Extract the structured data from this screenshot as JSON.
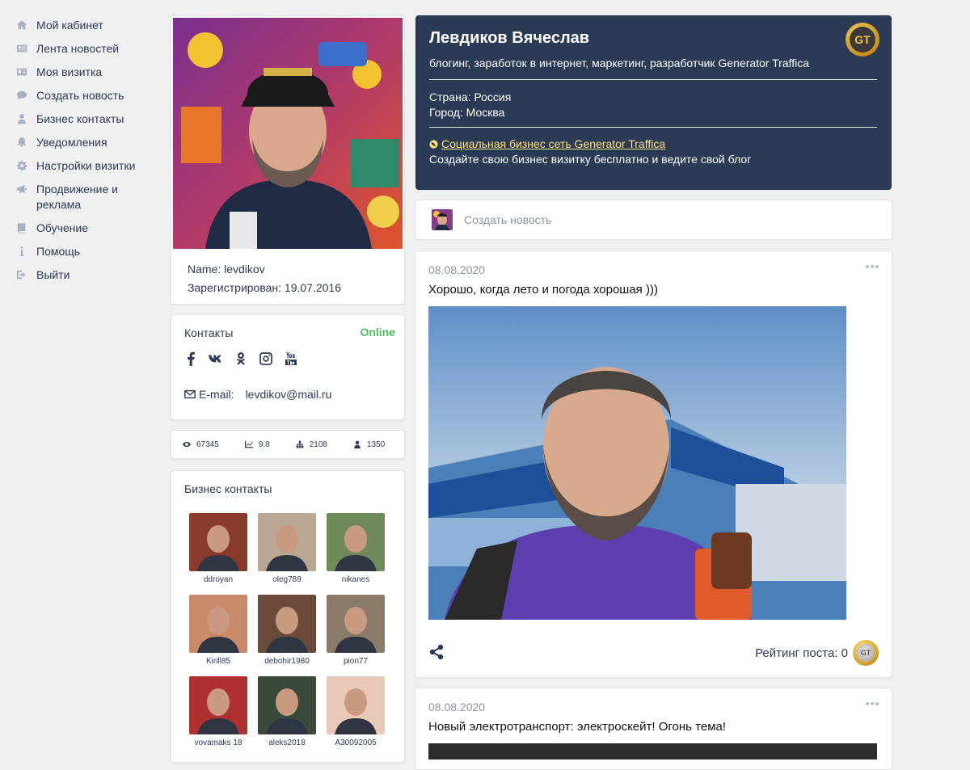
{
  "nav": {
    "items": [
      {
        "label": "Мой кабинет",
        "icon": "home-icon"
      },
      {
        "label": "Лента новостей",
        "icon": "newspaper-icon"
      },
      {
        "label": "Моя визитка",
        "icon": "id-card-icon"
      },
      {
        "label": "Создать новость",
        "icon": "comment-icon"
      },
      {
        "label": "Бизнес контакты",
        "icon": "user-icon"
      },
      {
        "label": "Уведомления",
        "icon": "bell-icon"
      },
      {
        "label": "Настройки визитки",
        "icon": "gear-icon"
      },
      {
        "label": "Продвижение и\nреклама",
        "icon": "bullhorn-icon"
      },
      {
        "label": "Обучение",
        "icon": "book-icon"
      },
      {
        "label": "Помощь",
        "icon": "info-icon"
      },
      {
        "label": "Выйти",
        "icon": "sign-out-icon"
      }
    ]
  },
  "profile": {
    "name_line": "Name: levdikov",
    "registered_line": "Зарегистрирован: 19.07.2016"
  },
  "contacts": {
    "title": "Контакты",
    "status": "Online",
    "socials": [
      "facebook-icon",
      "vk-icon",
      "odnoklassniki-icon",
      "instagram-icon",
      "youtube-icon"
    ],
    "email_label": "E-mail:",
    "email_value": "levdikov@mail.ru"
  },
  "stats": {
    "views": "67345",
    "rating": "9.8",
    "network": "2108",
    "contacts": "1350"
  },
  "biz": {
    "title": "Бизнес контакты",
    "people": [
      {
        "name": "ddroyan",
        "color": "#8a3a2a"
      },
      {
        "name": "oleg789",
        "color": "#b9a794"
      },
      {
        "name": "nikanes",
        "color": "#6f8a5a"
      },
      {
        "name": "Kirill85",
        "color": "#c98a6a"
      },
      {
        "name": "debohir1980",
        "color": "#6a4a3a"
      },
      {
        "name": "pion77",
        "color": "#8a7a6a"
      },
      {
        "name": "vovamaks 18",
        "color": "#b03030"
      },
      {
        "name": "aleks2018",
        "color": "#3a4a3a"
      },
      {
        "name": "A30092005",
        "color": "#e8c9b8"
      }
    ]
  },
  "header": {
    "name": "Левдиков Вячеслав",
    "tags": "блогинг, заработок в интернет, маркетинг, разработчик Generator Traffica",
    "country": "Страна: Россия",
    "city": "Город: Москва",
    "link_text": "Социальная бизнес сеть Generator Traffica",
    "subtitle": "Создайте свою бизнес визитку бесплатно и ведите свой блог",
    "badge_text": "GT"
  },
  "create_post": {
    "placeholder": "Создать новость"
  },
  "posts": [
    {
      "date": "08.08.2020",
      "text": "Хорошо, когда лето и погода хорошая )))",
      "rating_label": "Рейтинг поста: 0"
    },
    {
      "date": "08.08.2020",
      "text": "Новый электротранспорт: электроскейт! Огонь тема!"
    }
  ]
}
